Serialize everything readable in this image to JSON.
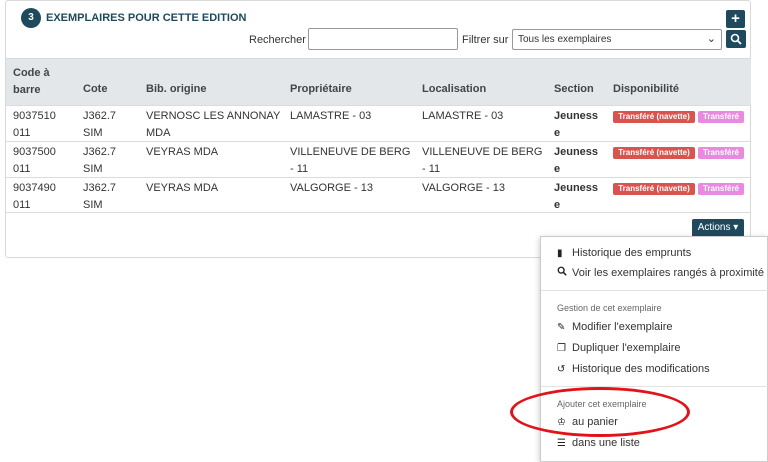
{
  "header": {
    "count": "3",
    "title": "EXEMPLAIRES POUR CETTE EDITION",
    "add_icon": "plus-icon"
  },
  "filters": {
    "search_label": "Rechercher",
    "search_value": "",
    "filter_label": "Filtrer sur",
    "filter_value": "Tous les exemplaires"
  },
  "table": {
    "columns": [
      "Code à barre",
      "Cote",
      "Bib. origine",
      "Propriétaire",
      "Localisation",
      "Section",
      "Disponibilité"
    ],
    "rows": [
      {
        "code": "9037510011",
        "cote": "J362.7 SIM",
        "bib": "VERNOSC LES ANNONAY MDA",
        "prop": "LAMASTRE - 03",
        "loc": "LAMASTRE - 03",
        "section": "Jeunesse",
        "status1": "Transféré (navette)",
        "status2": "Transféré"
      },
      {
        "code": "9037500011",
        "cote": "J362.7 SIM",
        "bib": "VEYRAS MDA",
        "prop": "VILLENEUVE DE BERG - 11",
        "loc": "VILLENEUVE DE BERG - 11",
        "section": "Jeunesse",
        "status1": "Transféré (navette)",
        "status2": "Transféré"
      },
      {
        "code": "9037490011",
        "cote": "J362.7 SIM",
        "bib": "VEYRAS MDA",
        "prop": "VALGORGE - 13",
        "loc": "VALGORGE - 13",
        "section": "Jeunesse",
        "status1": "Transféré (navette)",
        "status2": "Transféré"
      }
    ]
  },
  "actions": {
    "button_label": "Actions ▾",
    "menu": {
      "history": "Historique des emprunts",
      "nearby": "Voir les exemplaires rangés à proximité",
      "manage_header": "Gestion de cet exemplaire",
      "edit": "Modifier l'exemplaire",
      "duplicate": "Dupliquer l'exemplaire",
      "changes": "Historique des modifications",
      "add_header": "Ajouter cet exemplaire",
      "cart": "au panier",
      "list": "dans une liste"
    }
  },
  "colors": {
    "primary": "#1f4a5e",
    "status_red": "#d9534f",
    "status_pink": "#e88ae0",
    "annotation": "#e0131a"
  }
}
